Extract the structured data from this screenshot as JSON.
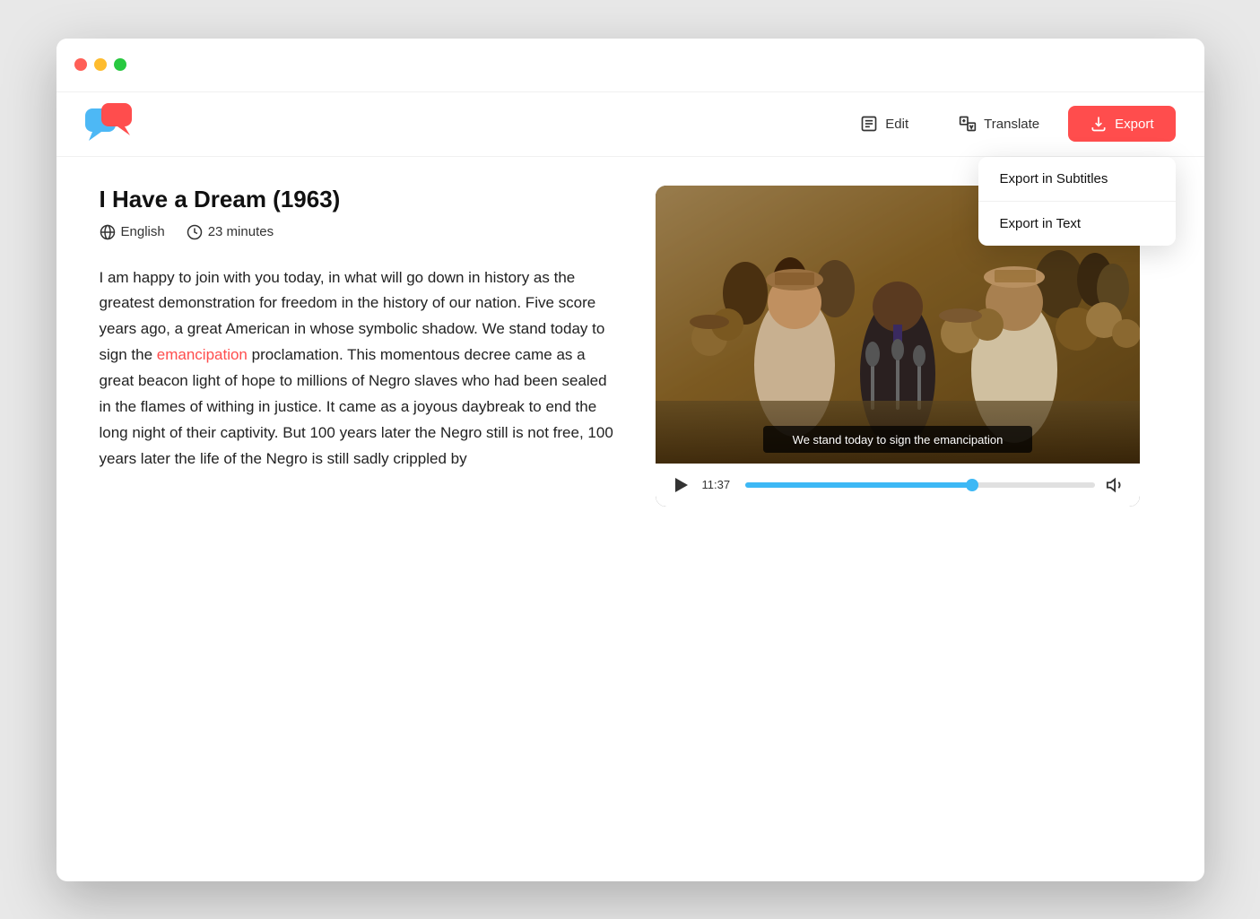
{
  "window": {
    "traffic_lights": [
      "red",
      "yellow",
      "green"
    ]
  },
  "header": {
    "edit_label": "Edit",
    "translate_label": "Translate",
    "export_label": "Export"
  },
  "dropdown": {
    "export_subtitles_label": "Export in Subtitles",
    "export_text_label": "Export in Text"
  },
  "document": {
    "title": "I Have a Dream (1963)",
    "language": "English",
    "duration": "23 minutes",
    "body_text_1": "I am happy to join with you today, in what will go down in history as the greatest demonstration for freedom in the history of our nation. Five score years ago, a great American in whose symbolic shadow. We stand today to sign the ",
    "highlight_word": "emancipation",
    "body_text_2": " proclamation. This momentous decree came as a great beacon light of hope to millions of Negro slaves who had been sealed in the flames of withing in justice. It came as a joyous daybreak to end the long night of their captivity. But 100 years later the Negro still is not free, 100 years later the life of the Negro is still sadly crippled by",
    "faded_text": "the life of the Negro is still sadly crippled by"
  },
  "video": {
    "subtitle_text": "We stand today to sign the emancipation",
    "current_time": "11:37",
    "progress_percent": 65
  }
}
